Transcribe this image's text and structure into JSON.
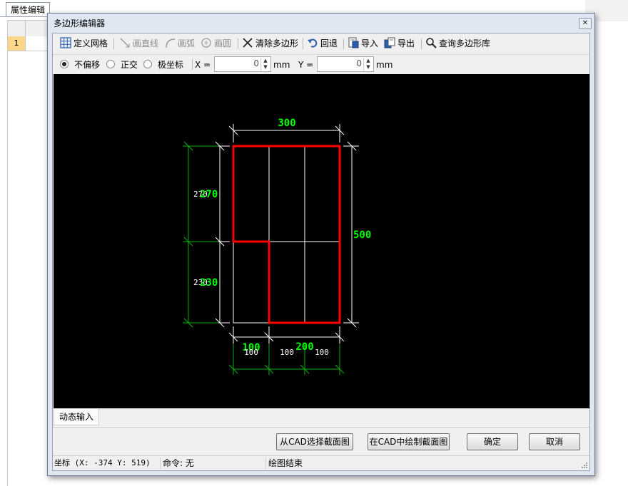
{
  "background_panel": {
    "tab_label": "属性编辑",
    "row_number": "1"
  },
  "dialog": {
    "title": "多边形编辑器",
    "toolbar": {
      "define_grid": "定义网格",
      "draw_line": "画直线",
      "draw_arc": "画弧",
      "draw_circle": "画圆",
      "clear_polygon": "清除多边形",
      "undo": "回退",
      "import": "导入",
      "export": "导出",
      "query_library": "查询多边形库"
    },
    "offset_options": {
      "no_offset": "不偏移",
      "orthogonal": "正交",
      "polar": "极坐标",
      "selected": "不偏移"
    },
    "x_field": {
      "label": "X =",
      "value": "0",
      "unit": "mm"
    },
    "y_field": {
      "label": "Y =",
      "value": "0",
      "unit": "mm"
    },
    "canvas": {
      "dimension_labels": {
        "top_width": "300",
        "right_height": "500",
        "left_upper_green": "270",
        "left_upper_white": "270",
        "left_lower_green": "230",
        "left_lower_white": "230",
        "bottom_left_green": "100",
        "bottom_right_green": "200",
        "bottom_white_1": "100",
        "bottom_white_2": "100",
        "bottom_white_3": "100"
      },
      "colors": {
        "background": "#000000",
        "polygon": "#ff0000",
        "grid": "#ffffff",
        "dimension_green": "#00c000",
        "label_green": "#00ff00"
      }
    },
    "dynamic_input_tab": "动态输入",
    "buttons": {
      "select_from_cad": "从CAD选择截面图",
      "draw_in_cad": "在CAD中绘制截面图",
      "ok": "确定",
      "cancel": "取消"
    },
    "status_bar": {
      "coords": "坐标 (X: -374 Y: 519)",
      "command": "命令: 无",
      "message": "绘图结束"
    }
  }
}
